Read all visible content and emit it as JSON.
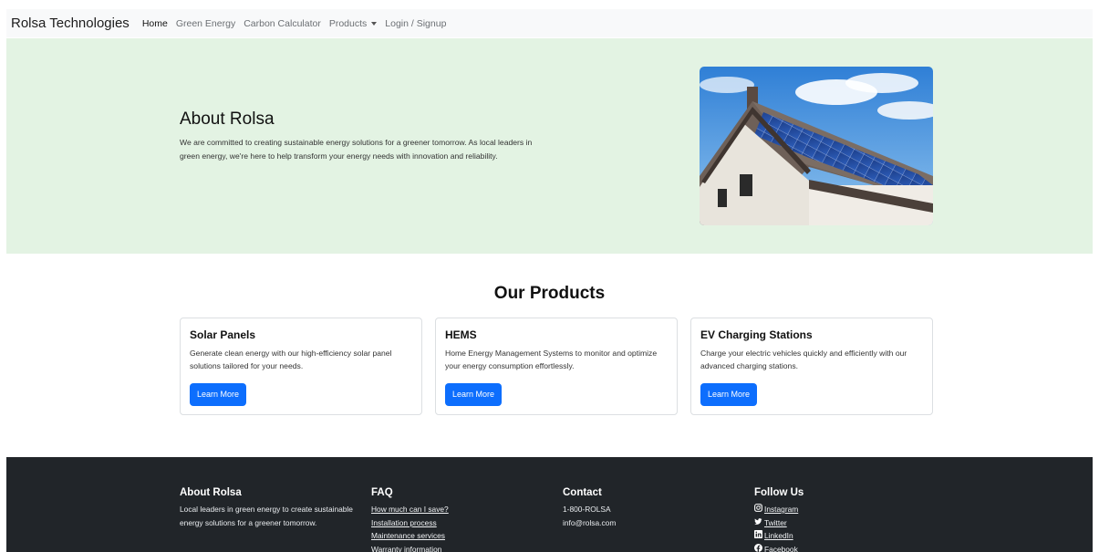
{
  "nav": {
    "brand": "Rolsa Technologies",
    "items": [
      {
        "label": "Home",
        "active": true
      },
      {
        "label": "Green Energy"
      },
      {
        "label": "Carbon Calculator"
      },
      {
        "label": "Products",
        "dropdown": true
      },
      {
        "label": "Login / Signup"
      }
    ]
  },
  "hero": {
    "title": "About Rolsa",
    "text": "We are committed to creating sustainable energy solutions for a greener tomorrow. As local leaders in green energy, we're here to help transform your energy needs with innovation and reliability.",
    "image": "house-with-solar-panels-photo"
  },
  "products": {
    "title": "Our Products",
    "cards": [
      {
        "title": "Solar Panels",
        "text": "Generate clean energy with our high-efficiency solar panel solutions tailored for your needs.",
        "button": "Learn More"
      },
      {
        "title": "HEMS",
        "text": "Home Energy Management Systems to monitor and optimize your energy consumption effortlessly.",
        "button": "Learn More"
      },
      {
        "title": "EV Charging Stations",
        "text": "Charge your electric vehicles quickly and efficiently with our advanced charging stations.",
        "button": "Learn More"
      }
    ]
  },
  "footer": {
    "about": {
      "title": "About Rolsa",
      "text": "Local leaders in green energy to create sustainable energy solutions for a greener tomorrow."
    },
    "faq": {
      "title": "FAQ",
      "links": [
        "How much can I save?",
        "Installation process",
        "Maintenance services",
        "Warranty information"
      ]
    },
    "contact": {
      "title": "Contact",
      "phone": "1-800-ROLSA",
      "email": "info@rolsa.com"
    },
    "follow": {
      "title": "Follow Us",
      "links": [
        {
          "label": "Instagram",
          "icon": "instagram-icon"
        },
        {
          "label": "Twitter",
          "icon": "twitter-icon"
        },
        {
          "label": "LinkedIn",
          "icon": "linkedin-icon"
        },
        {
          "label": "Facebook",
          "icon": "facebook-icon"
        }
      ]
    }
  },
  "colors": {
    "primary": "#0d6efd",
    "hero_bg": "#e3f3e3",
    "footer_bg": "#212529",
    "nav_bg": "#f8f9fa"
  }
}
